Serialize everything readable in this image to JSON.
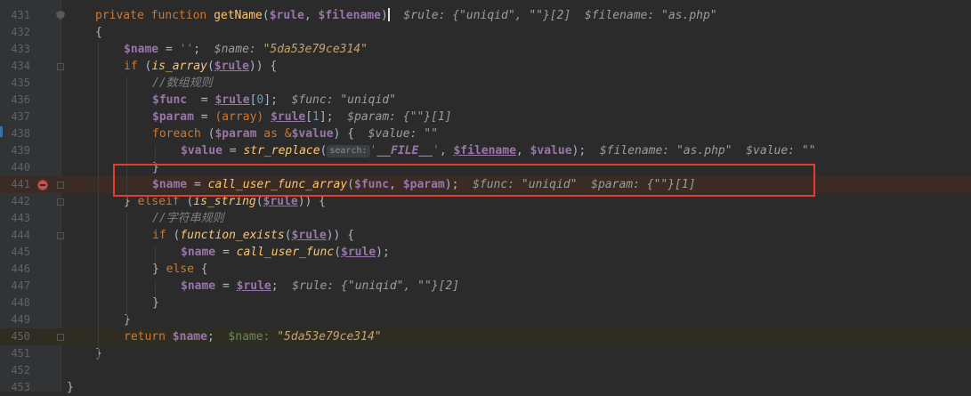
{
  "code_lines": [
    {
      "num": "431",
      "tokens": [
        {
          "t": "private ",
          "c": "kw"
        },
        {
          "t": "function ",
          "c": "kw"
        },
        {
          "t": "getName",
          "c": "fn"
        },
        {
          "t": "(",
          "c": ""
        },
        {
          "t": "$rule",
          "c": "varb"
        },
        {
          "t": ", ",
          "c": ""
        },
        {
          "t": "$filename",
          "c": "varb"
        },
        {
          "t": ")",
          "c": ""
        },
        {
          "t": "CARET",
          "c": "caret"
        },
        {
          "t": "  $rule: {\"uniqid\", \"\"}[2]  $filename: \"as.php\"",
          "c": "hint"
        }
      ]
    },
    {
      "num": "432",
      "tokens": [
        {
          "t": "{",
          "c": ""
        }
      ]
    },
    {
      "num": "433",
      "tokens": [
        {
          "t": "$name",
          "c": "varb"
        },
        {
          "t": " = ",
          "c": ""
        },
        {
          "t": "''",
          "c": "str"
        },
        {
          "t": ";  ",
          "c": ""
        },
        {
          "t": "$name: ",
          "c": "hint"
        },
        {
          "t": "\"5da53e79ce314\"",
          "c": "hint-str"
        }
      ]
    },
    {
      "num": "434",
      "tokens": [
        {
          "t": "if ",
          "c": "kw"
        },
        {
          "t": "(",
          "c": ""
        },
        {
          "t": "is_array",
          "c": "call"
        },
        {
          "t": "(",
          "c": ""
        },
        {
          "t": "$rule",
          "c": "varu"
        },
        {
          "t": ")) {",
          "c": ""
        }
      ]
    },
    {
      "num": "435",
      "tokens": [
        {
          "t": "//数组规则",
          "c": "cmt"
        }
      ]
    },
    {
      "num": "436",
      "tokens": [
        {
          "t": "$func",
          "c": "varb"
        },
        {
          "t": "  = ",
          "c": ""
        },
        {
          "t": "$rule",
          "c": "varu"
        },
        {
          "t": "[",
          "c": ""
        },
        {
          "t": "0",
          "c": "num"
        },
        {
          "t": "];  ",
          "c": ""
        },
        {
          "t": "$func: \"uniqid\"",
          "c": "hint"
        }
      ]
    },
    {
      "num": "437",
      "tokens": [
        {
          "t": "$param",
          "c": "varb"
        },
        {
          "t": " = ",
          "c": ""
        },
        {
          "t": "(array) ",
          "c": "cast"
        },
        {
          "t": "$rule",
          "c": "varu"
        },
        {
          "t": "[",
          "c": ""
        },
        {
          "t": "1",
          "c": "num"
        },
        {
          "t": "];  ",
          "c": ""
        },
        {
          "t": "$param: {\"\"}[1]",
          "c": "hint"
        }
      ]
    },
    {
      "num": "438",
      "tokens": [
        {
          "t": "foreach ",
          "c": "kw"
        },
        {
          "t": "(",
          "c": ""
        },
        {
          "t": "$param",
          "c": "varb"
        },
        {
          "t": " as ",
          "c": "kw"
        },
        {
          "t": "&",
          "c": "kw"
        },
        {
          "t": "$value",
          "c": "varb"
        },
        {
          "t": ") {  ",
          "c": ""
        },
        {
          "t": "$value: \"\"",
          "c": "hint"
        }
      ]
    },
    {
      "num": "439",
      "tokens": [
        {
          "t": "$value",
          "c": "varb"
        },
        {
          "t": " = ",
          "c": ""
        },
        {
          "t": "str_replace",
          "c": "call"
        },
        {
          "t": "(",
          "c": ""
        },
        {
          "t": "search:",
          "c": "param-hint"
        },
        {
          "t": "'",
          "c": "str"
        },
        {
          "t": "__FILE__",
          "c": "const"
        },
        {
          "t": "'",
          "c": "str"
        },
        {
          "t": ", ",
          "c": ""
        },
        {
          "t": "$filename",
          "c": "varu"
        },
        {
          "t": ", ",
          "c": ""
        },
        {
          "t": "$value",
          "c": "varb"
        },
        {
          "t": ");  ",
          "c": ""
        },
        {
          "t": "$filename: \"as.php\"  $value: \"\"",
          "c": "hint"
        }
      ]
    },
    {
      "num": "440",
      "tokens": [
        {
          "t": "}",
          "c": ""
        }
      ]
    },
    {
      "num": "441",
      "tokens": [
        {
          "t": "$name",
          "c": "varb"
        },
        {
          "t": " = ",
          "c": ""
        },
        {
          "t": "call_user_func_array",
          "c": "call"
        },
        {
          "t": "(",
          "c": ""
        },
        {
          "t": "$func",
          "c": "varb"
        },
        {
          "t": ", ",
          "c": ""
        },
        {
          "t": "$param",
          "c": "varb"
        },
        {
          "t": ");  ",
          "c": ""
        },
        {
          "t": "$func: \"uniqid\"  $param: {\"\"}[1]",
          "c": "hint"
        }
      ]
    },
    {
      "num": "442",
      "tokens": [
        {
          "t": "} ",
          "c": ""
        },
        {
          "t": "elseif ",
          "c": "kw"
        },
        {
          "t": "(",
          "c": ""
        },
        {
          "t": "is_string",
          "c": "call"
        },
        {
          "t": "(",
          "c": ""
        },
        {
          "t": "$rule",
          "c": "varu"
        },
        {
          "t": ")) {",
          "c": ""
        }
      ]
    },
    {
      "num": "443",
      "tokens": [
        {
          "t": "//字符串规则",
          "c": "cmt"
        }
      ]
    },
    {
      "num": "444",
      "tokens": [
        {
          "t": "if ",
          "c": "kw"
        },
        {
          "t": "(",
          "c": ""
        },
        {
          "t": "function_exists",
          "c": "call"
        },
        {
          "t": "(",
          "c": ""
        },
        {
          "t": "$rule",
          "c": "varu"
        },
        {
          "t": ")) {",
          "c": ""
        }
      ]
    },
    {
      "num": "445",
      "tokens": [
        {
          "t": "$name",
          "c": "varb"
        },
        {
          "t": " = ",
          "c": ""
        },
        {
          "t": "call_user_func",
          "c": "call"
        },
        {
          "t": "(",
          "c": ""
        },
        {
          "t": "$rule",
          "c": "varu"
        },
        {
          "t": ");",
          "c": ""
        }
      ]
    },
    {
      "num": "446",
      "tokens": [
        {
          "t": "} ",
          "c": ""
        },
        {
          "t": "else ",
          "c": "kw"
        },
        {
          "t": "{",
          "c": ""
        }
      ]
    },
    {
      "num": "447",
      "tokens": [
        {
          "t": "$name",
          "c": "varb"
        },
        {
          "t": " = ",
          "c": ""
        },
        {
          "t": "$rule",
          "c": "varu"
        },
        {
          "t": ";  ",
          "c": ""
        },
        {
          "t": "$rule: {\"uniqid\", \"\"}[2]",
          "c": "hint"
        }
      ]
    },
    {
      "num": "448",
      "tokens": [
        {
          "t": "}",
          "c": ""
        }
      ]
    },
    {
      "num": "449",
      "tokens": [
        {
          "t": "}",
          "c": ""
        }
      ]
    },
    {
      "num": "450",
      "tokens": [
        {
          "t": "return ",
          "c": "kw"
        },
        {
          "t": "$name",
          "c": "varb"
        },
        {
          "t": ";  ",
          "c": ""
        },
        {
          "t": "$name: ",
          "c": "str"
        },
        {
          "t": "\"5da53e79ce314\"",
          "c": "hint-str"
        }
      ]
    },
    {
      "num": "451",
      "tokens": [
        {
          "t": "}",
          "c": ""
        }
      ]
    },
    {
      "num": "452",
      "tokens": []
    },
    {
      "num": "453",
      "tokens": [
        {
          "t": "}",
          "c": ""
        }
      ]
    }
  ],
  "highlight": {
    "current_line": "450",
    "breakpoint_line": "441",
    "boxed_lines": [
      "440",
      "441"
    ]
  },
  "icons": {
    "breakpoint": "breakpoint-icon",
    "gutter_mark": "shield-icon"
  },
  "colors": {
    "background": "#2b2b2b",
    "keyword": "#cc7832",
    "function": "#ffc66d",
    "variable": "#9876aa",
    "string": "#6a8759",
    "comment": "#808080",
    "annotation_box": "#e43c2f"
  }
}
